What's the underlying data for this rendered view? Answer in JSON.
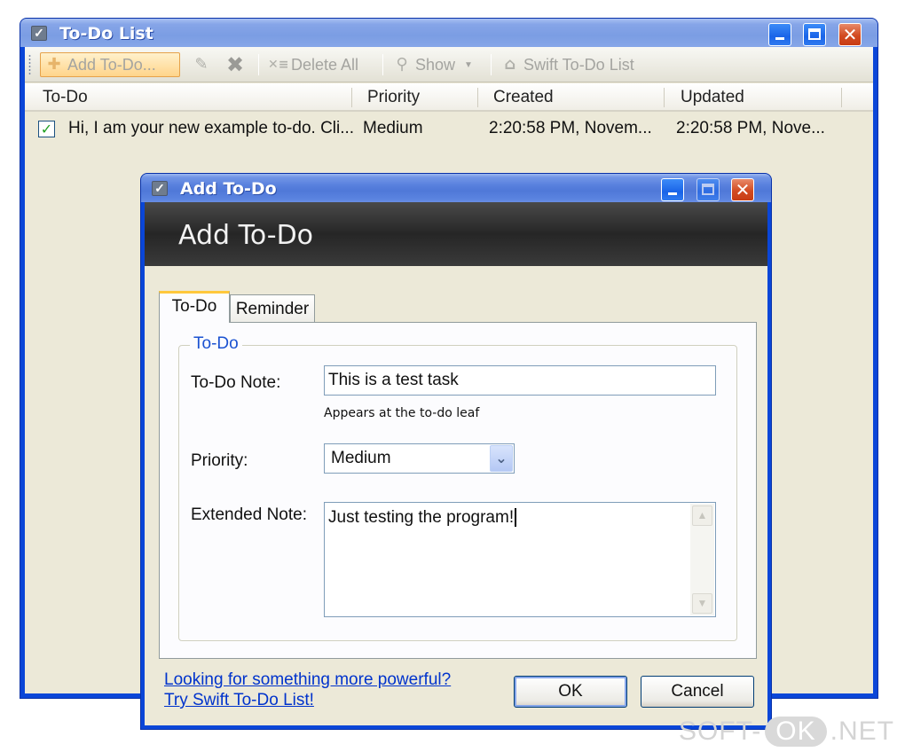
{
  "main_window": {
    "title": "To-Do List",
    "toolbar": {
      "add_label": "Add To-Do...",
      "delete_all_label": "Delete All",
      "show_label": "Show",
      "swift_label": "Swift To-Do List"
    },
    "columns": [
      "To-Do",
      "Priority",
      "Created",
      "Updated"
    ],
    "rows": [
      {
        "checked": true,
        "todo": "Hi, I am your new example to-do. Cli...",
        "priority": "Medium",
        "created": "2:20:58 PM, Novem...",
        "updated": "2:20:58 PM, Nove..."
      }
    ]
  },
  "dialog": {
    "title": "Add To-Do",
    "banner_title": "Add To-Do",
    "tabs": [
      "To-Do",
      "Reminder"
    ],
    "selected_tab": "To-Do",
    "group_title": "To-Do",
    "note_label": "To-Do Note:",
    "note_value": "This is a test task",
    "note_hint": "Appears at the to-do leaf",
    "priority_label": "Priority:",
    "priority_value": "Medium",
    "extended_label": "Extended Note:",
    "extended_value": "Just testing the program!",
    "link_line1": "Looking for something more powerful?",
    "link_line2": "Try Swift To-Do List!",
    "ok_label": "OK",
    "cancel_label": "Cancel"
  },
  "watermark": {
    "left": "SOFT-",
    "middle": "OK",
    "right": ".NET"
  },
  "colors": {
    "xp_title_blue": "#0a46d8",
    "window_face": "#ece9d8",
    "link_blue": "#0033cc",
    "group_title_blue": "#1b52d1"
  }
}
